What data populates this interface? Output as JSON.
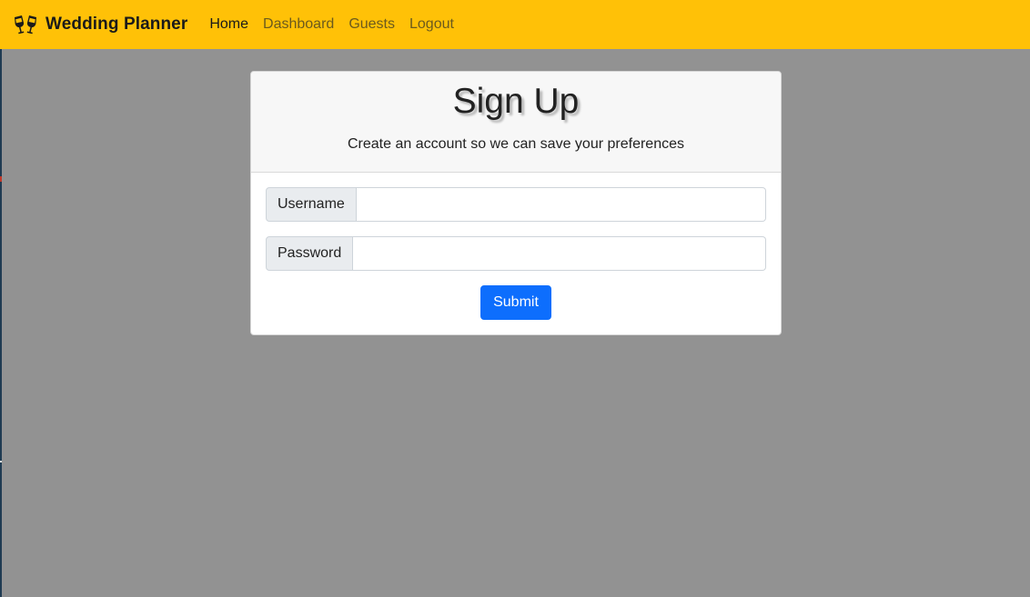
{
  "navbar": {
    "brand_icon": "champagne-glasses-icon",
    "brand": "Wedding Planner",
    "links": [
      {
        "label": "Home",
        "active": true
      },
      {
        "label": "Dashboard",
        "active": false
      },
      {
        "label": "Guests",
        "active": false
      },
      {
        "label": "Logout",
        "active": false
      }
    ],
    "background_color": "#ffc107"
  },
  "card": {
    "title": "Sign Up",
    "subtitle": "Create an account so we can save your preferences",
    "fields": [
      {
        "label": "Username",
        "value": "",
        "placeholder": ""
      },
      {
        "label": "Password",
        "value": "",
        "placeholder": ""
      }
    ],
    "submit_label": "Submit",
    "submit_color": "#0d6efd"
  },
  "page_background": "#929292"
}
